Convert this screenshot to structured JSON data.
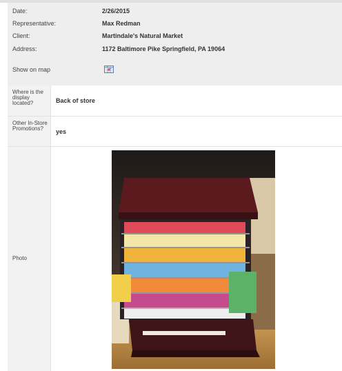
{
  "summary": {
    "date": {
      "label": "Date:",
      "value": "2/26/2015"
    },
    "representative": {
      "label": "Representative:",
      "value": "Max Redman"
    },
    "client": {
      "label": "Client:",
      "value": "Martindale's Natural Market"
    },
    "address": {
      "label": "Address:",
      "value": "1172 Baltimore Pike Springfield, PA 19064"
    },
    "show_on_map": {
      "label": "Show on map",
      "icon": "map-icon"
    }
  },
  "details": {
    "display_location": {
      "label": "Where is the display located?",
      "value": "Back of store"
    },
    "other_promotions": {
      "label": "Other In-Store Promotions?",
      "value": "yes"
    },
    "photo": {
      "label": "Photo",
      "image_icon": "display-cooler-photo"
    }
  },
  "colors": {
    "summary_bg": "#eeeeee",
    "label_bg": "#f2f2f2",
    "border": "#e2e2e2"
  }
}
